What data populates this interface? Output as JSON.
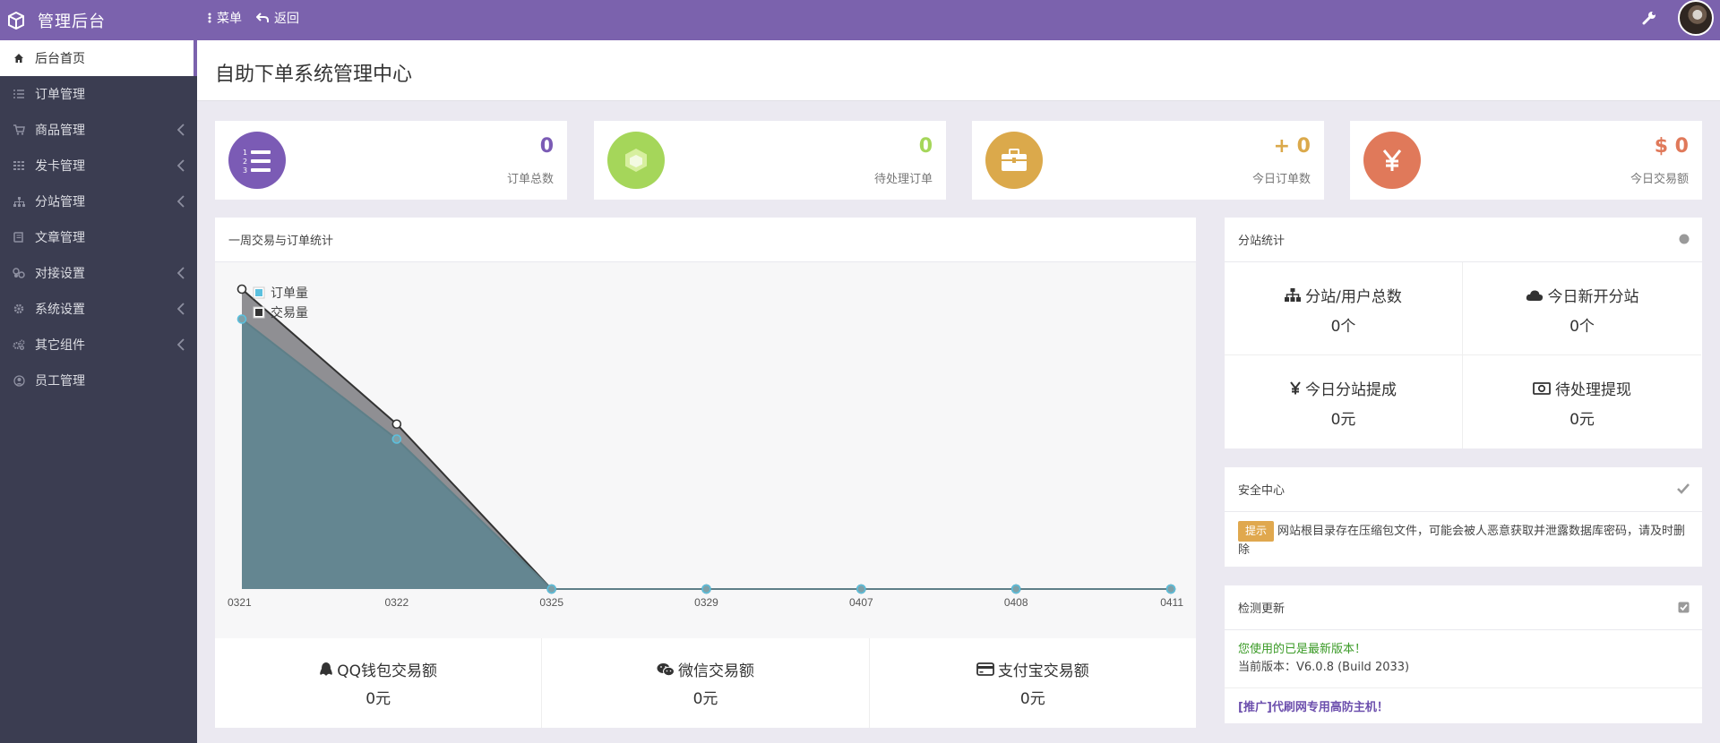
{
  "header": {
    "brand": "管理后台",
    "menu_label": "菜单",
    "back_label": "返回",
    "accent_color": "#7b62ad"
  },
  "sidebar": {
    "items": [
      {
        "label": "后台首页",
        "icon": "home-icon",
        "active": true
      },
      {
        "label": "订单管理",
        "icon": "list-icon"
      },
      {
        "label": "商品管理",
        "icon": "cart-icon",
        "submenu": true
      },
      {
        "label": "发卡管理",
        "icon": "grid-icon",
        "submenu": true
      },
      {
        "label": "分站管理",
        "icon": "sitemap-icon",
        "submenu": true
      },
      {
        "label": "文章管理",
        "icon": "book-icon"
      },
      {
        "label": "对接设置",
        "icon": "link-icon",
        "submenu": true
      },
      {
        "label": "系统设置",
        "icon": "gear-icon",
        "submenu": true
      },
      {
        "label": "其它组件",
        "icon": "cogs-icon",
        "submenu": true
      },
      {
        "label": "员工管理",
        "icon": "user-icon"
      }
    ]
  },
  "page_title": "自助下单系统管理中心",
  "stats": [
    {
      "value": "0",
      "label": "订单总数",
      "color": "#7b5bb5"
    },
    {
      "value": "0",
      "label": "待处理订单",
      "color": "#a5d65a"
    },
    {
      "value": "+ 0",
      "label": "今日订单数",
      "color": "#dba94b"
    },
    {
      "value": "$ 0",
      "label": "今日交易额",
      "color": "#e0795a"
    }
  ],
  "weekly_panel": {
    "title": "一周交易与订单统计"
  },
  "chart_data": {
    "type": "area",
    "categories": [
      "0321",
      "0322",
      "0325",
      "0329",
      "0407",
      "0408",
      "0411"
    ],
    "series": [
      {
        "name": "订单量",
        "values": [
          20,
          11,
          0,
          0,
          0,
          0,
          0
        ],
        "color": "#5bc0de"
      },
      {
        "name": "交易量",
        "values": [
          18,
          10,
          0,
          0,
          0,
          0,
          0
        ],
        "color": "#3e5662"
      }
    ],
    "legend_position": "top-left"
  },
  "payment_stats": [
    {
      "label": "QQ钱包交易额",
      "value": "0元",
      "icon": "qq-icon"
    },
    {
      "label": "微信交易额",
      "value": "0元",
      "icon": "wechat-icon"
    },
    {
      "label": "支付宝交易额",
      "value": "0元",
      "icon": "credit-card-icon"
    }
  ],
  "substation": {
    "title": "分站统计",
    "cells": [
      {
        "label": "分站/用户总数",
        "value": "0个",
        "icon": "sitemap-icon"
      },
      {
        "label": "今日新开分站",
        "value": "0个",
        "icon": "cloud-icon"
      },
      {
        "label": "今日分站提成",
        "value": "0元",
        "icon": "yen-icon"
      },
      {
        "label": "待处理提现",
        "value": "0元",
        "icon": "money-icon"
      }
    ]
  },
  "security": {
    "title": "安全中心",
    "badge": "提示",
    "message": "网站根目录存在压缩包文件，可能会被人恶意获取并泄露数据库密码，请及时删除"
  },
  "update": {
    "title": "检测更新",
    "status": "您使用的已是最新版本！",
    "version": "当前版本：V6.0.8 (Build 2033)",
    "ad": "[推广]代刷网专用高防主机！"
  }
}
